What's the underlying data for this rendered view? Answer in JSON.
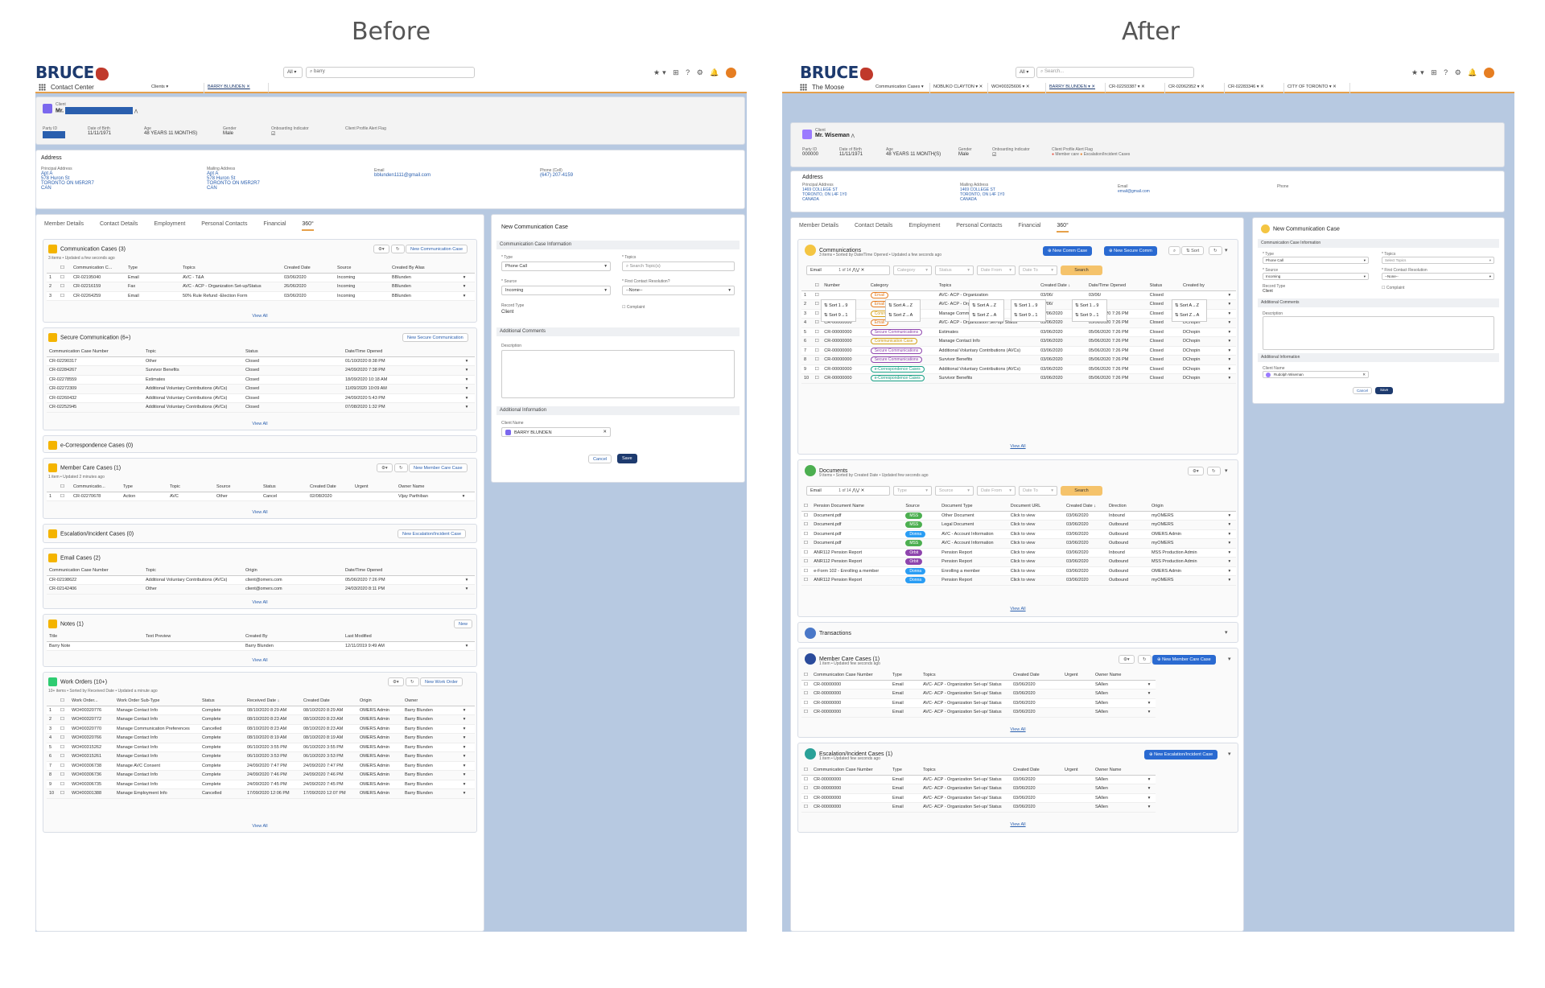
{
  "headings": {
    "before": "Before",
    "after": "After"
  },
  "before": {
    "logo": "BRUCE",
    "scope": "All",
    "search_value": "barry",
    "app_name": "Contact Center",
    "tabs": [
      "Clients",
      "BARRY BLUNDEN"
    ],
    "client": {
      "label": "Client",
      "name": "Mr."
    },
    "fields": [
      {
        "label": "Party ID",
        "value": ""
      },
      {
        "label": "Date of Birth",
        "value": "11/11/1971"
      },
      {
        "label": "Age",
        "value": "48 YEARS 11 MONTHS)"
      },
      {
        "label": "Gender",
        "value": "Male"
      },
      {
        "label": "Onboarding Indicator",
        "value": ""
      },
      {
        "label": "Client Profile Alert Flag",
        "value": ""
      }
    ],
    "address": {
      "title": "Address",
      "principal_label": "Principal Address",
      "principal": [
        "Apt A",
        "578 Huron St",
        "TORONTO ON M5R2R7",
        "CAN"
      ],
      "mailing_label": "Mailing Address",
      "mailing": [
        "Apt A",
        "578 Huron St",
        "TORONTO ON M5R2R7",
        "CAN"
      ],
      "email_label": "Email",
      "email": "bblunden1111@gmail.com",
      "phone_label": "Phone (Cell)",
      "phone": "(647) 207-4159"
    },
    "record_tabs": [
      "Member Details",
      "Contact Details",
      "Employment",
      "Personal Contacts",
      "Financial",
      "360°"
    ],
    "comm": {
      "title": "Communication Cases (3)",
      "sub": "3 items • Updated a few seconds ago",
      "button": "New Communication Case",
      "headers": [
        "Communication C...",
        "Type",
        "Topics",
        "Created Date",
        "Source",
        "Created By Alias"
      ],
      "rows": [
        [
          "1",
          "CR-02195040",
          "Email",
          "AVC - T&A",
          "03/06/2020",
          "Incoming",
          "BBlunden"
        ],
        [
          "2",
          "CR-02216159",
          "Fax",
          "AVC - ACP - Organization Set-up/Status",
          "26/06/2020",
          "Incoming",
          "BBlunden"
        ],
        [
          "3",
          "CR-02264259",
          "Email",
          "50% Rule Refund -Election Form",
          "03/06/2020",
          "Incoming",
          "BBlunden"
        ]
      ],
      "view_all": "View All"
    },
    "secure": {
      "title": "Secure Communication (6+)",
      "button": "New Secure Communication",
      "headers": [
        "Communication Case Number",
        "Topic",
        "Status",
        "Date/Time Opened"
      ],
      "rows": [
        [
          "CR-02290317",
          "Other",
          "Closed",
          "01/10/2020 8:38 PM"
        ],
        [
          "CR-02284267",
          "Survivor Benefits",
          "Closed",
          "24/09/2020 7:38 PM"
        ],
        [
          "CR-02278559",
          "Estimates",
          "Closed",
          "18/09/2020 10:18 AM"
        ],
        [
          "CR-02272309",
          "Additional Voluntary Contributions (AVCs)",
          "Closed",
          "11/09/2020 10:09 AM"
        ],
        [
          "CR-02260432",
          "Additional Voluntary Contributions (AVCs)",
          "Closed",
          "24/09/2020 5:43 PM"
        ],
        [
          "CR-02252945",
          "Additional Voluntary Contributions (AVCs)",
          "Closed",
          "07/08/2020 1:32 PM"
        ]
      ],
      "view_all": "View All"
    },
    "ecorr": {
      "title": "e-Correspondence Cases (0)"
    },
    "member": {
      "title": "Member Care Cases (1)",
      "sub": "1 item • Updated 2 minutes ago",
      "button": "New Member Care Case",
      "headers": [
        "Communicatio...",
        "Type",
        "Topic",
        "Source",
        "Status",
        "Created Date",
        "Urgent",
        "Owner Name"
      ],
      "rows": [
        [
          "1",
          "CR-02270678",
          "Action",
          "AVC",
          "Other",
          "Cancel",
          "02/08/2020",
          "",
          "Vijay Parthiban"
        ]
      ],
      "view_all": "View All"
    },
    "escal": {
      "title": "Escalation/Incident Cases (0)",
      "button": "New Escalation/Incident Case"
    },
    "email": {
      "title": "Email Cases (2)",
      "headers": [
        "Communication Case Number",
        "Topic",
        "Origin",
        "Date/Time Opened"
      ],
      "rows": [
        [
          "CR-02198622",
          "Additional Voluntary Contributions (AVCs)",
          "client@omers.com",
          "05/06/2020 7:26 PM"
        ],
        [
          "CR-02142406",
          "Other",
          "client@omers.com",
          "24/03/2020 8:11 PM"
        ]
      ],
      "view_all": "View All"
    },
    "notes": {
      "title": "Notes (1)",
      "button": "New",
      "headers": [
        "Title",
        "Text Preview",
        "Created By",
        "Last Modified"
      ],
      "rows": [
        [
          "Barry Note",
          "",
          "Barry Blunden",
          "12/11/2019 9:49 AM"
        ]
      ],
      "view_all": "View All"
    },
    "wo": {
      "title": "Work Orders (10+)",
      "sub": "10+ items • Sorted by Received Date • Updated a minute ago",
      "button": "New Work Order",
      "headers": [
        "Work Order...",
        "Work Order Sub-Type",
        "Status",
        "Received Date ↓",
        "Created Date",
        "Origin",
        "Owner"
      ],
      "rows": [
        [
          "1",
          "WO#00320776",
          "Manage Contact Info",
          "Complete",
          "08/10/2020 8:29 AM",
          "08/10/2020 8:29 AM",
          "OMERS Admin",
          "Barry Blunden"
        ],
        [
          "2",
          "WO#00320772",
          "Manage Contact Info",
          "Complete",
          "08/10/2020 8:23 AM",
          "08/10/2020 8:23 AM",
          "OMERS Admin",
          "Barry Blunden"
        ],
        [
          "3",
          "WO#00320770",
          "Manage Communication Preferences",
          "Cancelled",
          "08/10/2020 8:23 AM",
          "08/10/2020 8:23 AM",
          "OMERS Admin",
          "Barry Blunden"
        ],
        [
          "4",
          "WO#00320766",
          "Manage Contact Info",
          "Complete",
          "08/10/2020 8:19 AM",
          "08/10/2020 8:19 AM",
          "OMERS Admin",
          "Barry Blunden"
        ],
        [
          "5",
          "WO#00315262",
          "Manage Contact Info",
          "Complete",
          "06/10/2020 3:55 PM",
          "06/10/2020 3:55 PM",
          "OMERS Admin",
          "Barry Blunden"
        ],
        [
          "6",
          "WO#00315261",
          "Manage Contact Info",
          "Complete",
          "06/10/2020 3:53 PM",
          "06/10/2020 3:53 PM",
          "OMERS Admin",
          "Barry Blunden"
        ],
        [
          "7",
          "WO#00306738",
          "Manage AVC Consent",
          "Complete",
          "24/09/2020 7:47 PM",
          "24/09/2020 7:47 PM",
          "OMERS Admin",
          "Barry Blunden"
        ],
        [
          "8",
          "WO#00306736",
          "Manage Contact Info",
          "Complete",
          "24/09/2020 7:46 PM",
          "24/09/2020 7:46 PM",
          "OMERS Admin",
          "Barry Blunden"
        ],
        [
          "9",
          "WO#00306735",
          "Manage Contact Info",
          "Complete",
          "24/09/2020 7:45 PM",
          "24/09/2020 7:45 PM",
          "OMERS Admin",
          "Barry Blunden"
        ],
        [
          "10",
          "WO#00301388",
          "Manage Employment Info",
          "Cancelled",
          "17/09/2020 12:06 PM",
          "17/09/2020 12:07 PM",
          "OMERS Admin",
          "Barry Blunden"
        ]
      ],
      "view_all": "View All"
    },
    "form": {
      "title": "New Communication Case",
      "sec_info": "Communication Case Information",
      "type_label": "* Type",
      "type_value": "Phone Call",
      "topics_label": "* Topics",
      "topics_placeholder": "Search Topic(s)",
      "source_label": "* Source",
      "source_value": "Incoming",
      "contact_label": "* First Contact Resolution?",
      "contact_value": "--None--",
      "record_label": "Record Type",
      "record_value": "Client",
      "complaint_label": "Complaint",
      "sec_comments": "Additional Comments",
      "desc_label": "Description",
      "sec_addl": "Additional Information",
      "client_label": "Client Name",
      "client_value": "BARRY BLUNDEN",
      "cancel": "Cancel",
      "save": "Save"
    }
  },
  "after": {
    "logo": "BRUCE",
    "scope": "All",
    "search_placeholder": "Search...",
    "app_name": "The Moose",
    "tabs": [
      "Communication Cases",
      "NOBUKO CLAYTON",
      "WO#00325606",
      "BARRY BLUNDEN",
      "CR-02293387",
      "CR-02062952",
      "CR-02283346",
      "CITY OF TORONTO"
    ],
    "client": {
      "label": "Client",
      "name": "Mr. Wiseman"
    },
    "fields": [
      {
        "label": "Party ID",
        "value": "000000"
      },
      {
        "label": "Date of Birth",
        "value": "11/11/1971"
      },
      {
        "label": "Age",
        "value": "48 YEARS 11 MONTH(S)"
      },
      {
        "label": "Gender",
        "value": "Male"
      },
      {
        "label": "Onboarding Indicator",
        "value": ""
      },
      {
        "label": "Client Profile Alert Flag",
        "value": ""
      }
    ],
    "flags": [
      "Member care",
      "Escalation/Incident Cases"
    ],
    "address": {
      "title": "Address",
      "principal_label": "Principal Address",
      "principal": [
        "1469 COLLEGE ST",
        "TORONTO, ON L4F 1Y0",
        "CANADA"
      ],
      "mailing_label": "Mailing Address",
      "mailing": [
        "1469 COLLEGE ST",
        "TORONTO, ON L4F 1Y0",
        "CANADA"
      ],
      "email_label": "Email",
      "email": "email@gmail.com",
      "phone_label": "Phone"
    },
    "record_tabs": [
      "Member Details",
      "Contact Details",
      "Employment",
      "Personal Contacts",
      "Financial",
      "360°"
    ],
    "comms": {
      "title": "Communications",
      "sub": "3 items • Sorted by Date/Time Opened • Updated a few seconds ago",
      "btn1": "New Comm Case",
      "btn2": "New Secure Comm",
      "sort": "Sort",
      "filter_value": "Email",
      "filter_count": "1 of 14",
      "filters": [
        "Category",
        "Status",
        "Date From",
        "Date To"
      ],
      "search": "Search",
      "headers": [
        "Number",
        "Category",
        "Topics",
        "Created Date ↓",
        "Date/Time Opened",
        "Status",
        "Created by"
      ],
      "sort_opts": [
        "Sort 1→9",
        "Sort 9→1",
        "Sort A→Z",
        "Sort Z→A"
      ],
      "rows": [
        [
          "1",
          "",
          "Email",
          "AVC- ACP - Organization",
          "03/06/",
          "03/06/",
          "Closed",
          ""
        ],
        [
          "2",
          "",
          "Email",
          "AVC- ACP - Organization",
          "03/06/",
          "03/06/",
          "Closed",
          ""
        ],
        [
          "3",
          "CR-00000000",
          "Communication Case",
          "Manage Communication Pref",
          "03/06/2020",
          "05/06/2020 7:26 PM",
          "Closed",
          "DChopin"
        ],
        [
          "4",
          "CR-00000000",
          "Email",
          "AVC- ACP - Organization Set-up/ Status",
          "03/06/2020",
          "05/06/2020 7:26 PM",
          "Closed",
          "DChopin"
        ],
        [
          "5",
          "CR-00000000",
          "Secure Communications",
          "Estimates",
          "03/06/2020",
          "05/06/2020 7:26 PM",
          "Closed",
          "DChopin"
        ],
        [
          "6",
          "CR-00000000",
          "Communication Case",
          "Manage Contact Info",
          "03/06/2020",
          "05/06/2020 7:26 PM",
          "Closed",
          "DChopin"
        ],
        [
          "7",
          "CR-00000000",
          "Secure Communications",
          "Additional Voluntary Contributions (AVCs)",
          "03/06/2020",
          "05/06/2020 7:26 PM",
          "Closed",
          "DChopin"
        ],
        [
          "8",
          "CR-00000000",
          "Secure Communications",
          "Survivor Benefits",
          "03/06/2020",
          "05/06/2020 7:26 PM",
          "Closed",
          "DChopin"
        ],
        [
          "9",
          "CR-00000000",
          "e-Correspondence Cases",
          "Additional Voluntary Contributions (AVCs)",
          "03/06/2020",
          "05/06/2020 7:26 PM",
          "Closed",
          "DChopin"
        ],
        [
          "10",
          "CR-00000000",
          "e-Correspondence Cases",
          "Survivor Benefits",
          "03/06/2020",
          "05/06/2020 7:26 PM",
          "Closed",
          "DChopin"
        ]
      ],
      "view_all": "View All"
    },
    "docs": {
      "title": "Documents",
      "sub": "9 items • Sorted by Created Date • Updated few seconds ago",
      "filter_value": "Email",
      "filter_count": "1 of 14",
      "filters": [
        "Type",
        "Source",
        "Date From",
        "Date To"
      ],
      "search": "Search",
      "headers": [
        "Pension Document Name",
        "Source",
        "Document Type",
        "Document URL",
        "Created Date ↓",
        "Direction",
        "Origin"
      ],
      "rows": [
        [
          "Document.pdf",
          "MSS",
          "Other Document",
          "Click to view",
          "03/06/2020",
          "Inbound",
          "myOMERS"
        ],
        [
          "Document.pdf",
          "MSS",
          "Legal Document",
          "Click to view",
          "03/06/2020",
          "Outbound",
          "myOMERS"
        ],
        [
          "Document.pdf",
          "Donna",
          "AVC - Account Information",
          "Click to view",
          "03/06/2020",
          "Outbound",
          "OMERS Admin"
        ],
        [
          "Document.pdf",
          "MSS",
          "AVC - Account Information",
          "Click to view",
          "03/06/2020",
          "Outbound",
          "myOMERS"
        ],
        [
          "ANR112 Pension Report",
          "Orbit",
          "Pension Report",
          "Click to view",
          "03/06/2020",
          "Inbound",
          "MSS Production Admin"
        ],
        [
          "ANR112 Pension Report",
          "Orbit",
          "Pension Report",
          "Click to view",
          "03/06/2020",
          "Outbound",
          "MSS Production Admin"
        ],
        [
          "e-Form 102 - Enrolling a member",
          "Donna",
          "Enrolling a member",
          "Click to view",
          "03/06/2020",
          "Outbound",
          "OMERS Admin"
        ],
        [
          "ANR112 Pension Report",
          "Donna",
          "Pension Report",
          "Click to view",
          "03/06/2020",
          "Outbound",
          "myOMERS"
        ]
      ],
      "view_all": "View All"
    },
    "trans": {
      "title": "Transactions"
    },
    "member": {
      "title": "Member Care Cases (1)",
      "sub": "1 item • Updated few seconds ago",
      "button": "New Member Care Case",
      "headers": [
        "Communication Case Number",
        "Type",
        "Topics",
        "Created Date",
        "Urgent",
        "Owner Name"
      ],
      "rows": [
        [
          "CR-00000000",
          "Email",
          "AVC- ACP - Organization Set-up/ Status",
          "03/06/2020",
          "",
          "SAllen"
        ],
        [
          "CR-00000000",
          "Email",
          "AVC- ACP - Organization Set-up/ Status",
          "03/06/2020",
          "",
          "SAllen"
        ],
        [
          "CR-00000000",
          "Email",
          "AVC- ACP - Organization Set-up/ Status",
          "03/06/2020",
          "",
          "SAllen"
        ],
        [
          "CR-00000000",
          "Email",
          "AVC- ACP - Organization Set-up/ Status",
          "03/06/2020",
          "",
          "SAllen"
        ]
      ],
      "view_all": "View All"
    },
    "escal": {
      "title": "Escalation/Incident Cases (1)",
      "sub": "1 item • Updated few seconds ago",
      "button": "New Escalation/Incident Case",
      "headers": [
        "Communication Case Number",
        "Type",
        "Topics",
        "Created Date",
        "Urgent",
        "Owner Name"
      ],
      "rows": [
        [
          "CR-00000000",
          "Email",
          "AVC- ACP - Organization Set-up/ Status",
          "03/06/2020",
          "",
          "SAllen"
        ],
        [
          "CR-00000000",
          "Email",
          "AVC- ACP - Organization Set-up/ Status",
          "03/06/2020",
          "",
          "SAllen"
        ],
        [
          "CR-00000000",
          "Email",
          "AVC- ACP - Organization Set-up/ Status",
          "03/06/2020",
          "",
          "SAllen"
        ],
        [
          "CR-00000000",
          "Email",
          "AVC- ACP - Organization Set-up/ Status",
          "03/06/2020",
          "",
          "SAllen"
        ]
      ],
      "view_all": "View All"
    },
    "form": {
      "title": "New Communication Case",
      "sec_info": "Communication Case Information",
      "type_label": "* Type",
      "type_value": "Phone Call",
      "topics_label": "* Topics",
      "topics_placeholder": "Select Topics",
      "source_label": "* Source",
      "source_value": "Incoming",
      "contact_label": "* First Contact Resolution",
      "contact_value": "--None--",
      "record_label": "Record Type",
      "record_value": "Client",
      "complaint_label": "Complaint",
      "sec_comments": "Additional Comments",
      "desc_label": "Description",
      "sec_addl": "Additional Information",
      "client_label": "Client Name",
      "client_value": "Rudolph Wiseman",
      "cancel": "Cancel",
      "save": "Save"
    }
  },
  "colors": {
    "accent": "#e6a04a",
    "brand": "#1d3a6e",
    "panel_bg": "#b7c9e1",
    "link": "#2a5fae",
    "button": "#2a6ad1",
    "search_btn": "#f5c36b"
  }
}
